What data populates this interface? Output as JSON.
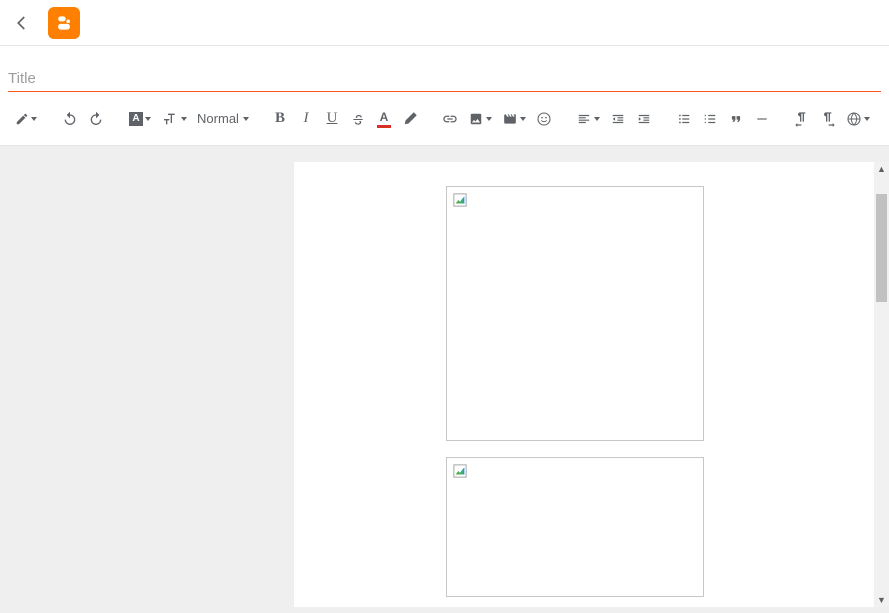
{
  "header": {
    "back_aria": "Back"
  },
  "title_field": {
    "placeholder": "Title",
    "value": ""
  },
  "toolbar": {
    "paragraph_select": "Normal",
    "font_family_letter": "A",
    "text_color_letter": "A",
    "highlight_glyph": "✎",
    "bold": "B",
    "italic": "I",
    "underline": "U",
    "strikethrough_glyph": "S",
    "link_glyph": "⇔",
    "emoji_glyph": "☺",
    "quote_glyph": "❝",
    "hr_glyph": "—"
  },
  "canvas": {
    "scrollbar_up": "▲",
    "scrollbar_down": "▼"
  }
}
